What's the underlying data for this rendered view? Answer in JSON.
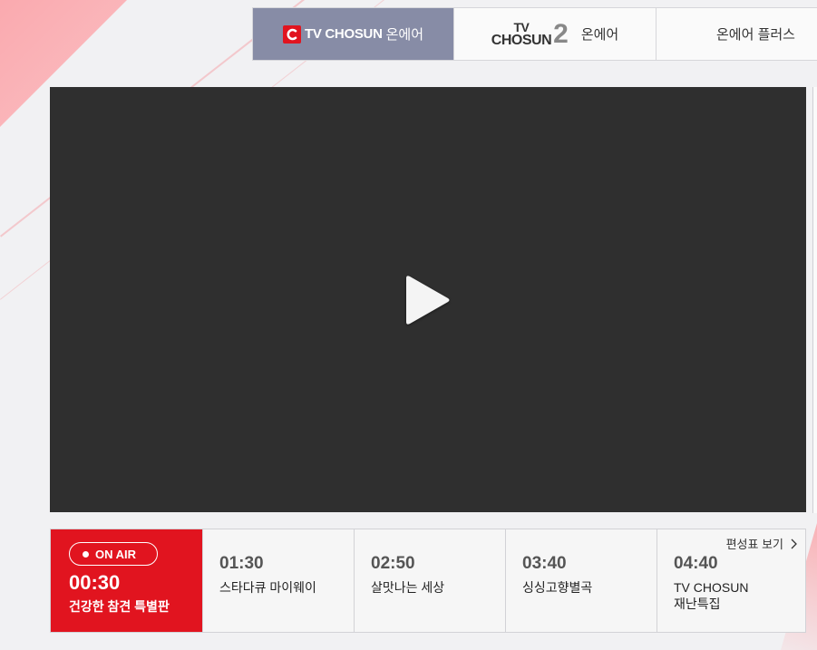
{
  "tabs": [
    {
      "brand": "TV CHOSUN",
      "label": "온에어",
      "active": true
    },
    {
      "logo_top": "TV",
      "logo_bottom": "CHOSUN",
      "logo_num": "2",
      "label": "온에어",
      "active": false
    },
    {
      "label": "온에어 플러스",
      "active": false
    }
  ],
  "player": {
    "play_icon": "play-icon"
  },
  "schedule": {
    "onair": {
      "badge": "ON AIR",
      "time": "00:30",
      "title": "건강한 참견 특별판"
    },
    "slots": [
      {
        "time": "01:30",
        "title": "스타다큐 마이웨이"
      },
      {
        "time": "02:50",
        "title": "살맛나는 세상"
      },
      {
        "time": "03:40",
        "title": "싱싱고향별곡"
      },
      {
        "time": "04:40",
        "title": "TV CHOSUN\n재난특집"
      }
    ],
    "view_link": "편성표 보기"
  },
  "colors": {
    "accent_red": "#e1141f",
    "active_tab": "#878ca6",
    "player_bg": "#2f2f2f"
  }
}
